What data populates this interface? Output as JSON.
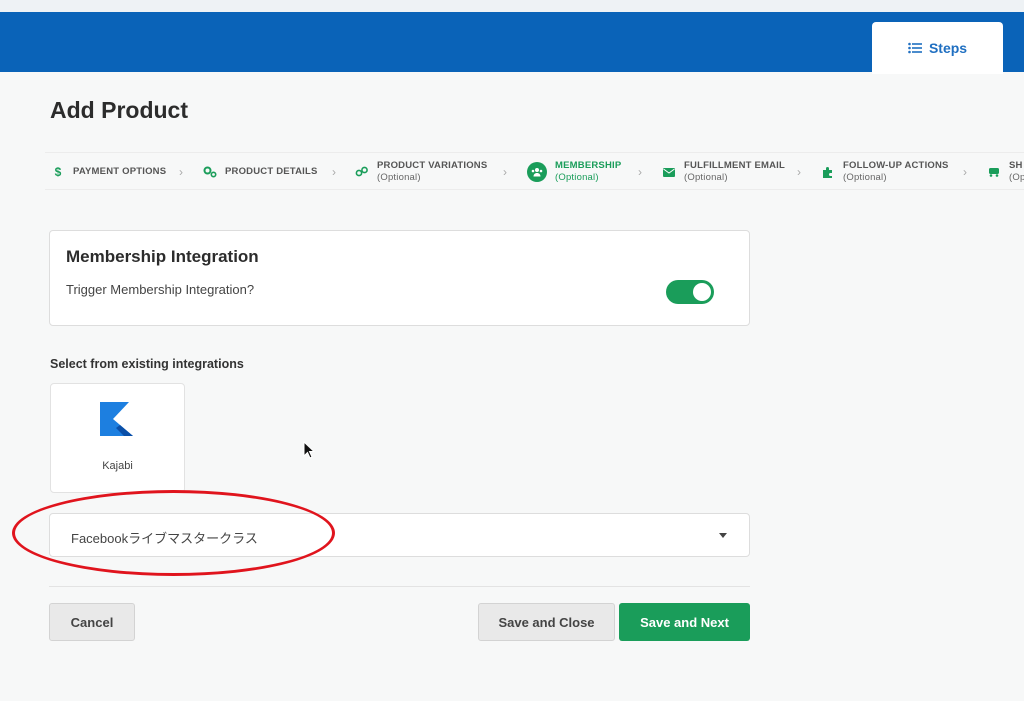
{
  "header": {
    "steps_label": "Steps",
    "steps_icon": "list-icon",
    "brand_color": "#0a63b8"
  },
  "page": {
    "title": "Add Product"
  },
  "wizard": {
    "accent_color": "#1a9d5a",
    "steps": [
      {
        "label": "PAYMENT OPTIONS",
        "sub": "",
        "icon": "dollar-icon",
        "active": false
      },
      {
        "label": "PRODUCT DETAILS",
        "sub": "",
        "icon": "gears-icon",
        "active": false
      },
      {
        "label": "PRODUCT VARIATIONS",
        "sub": "(Optional)",
        "icon": "variations-icon",
        "active": false
      },
      {
        "label": "MEMBERSHIP",
        "sub": "(Optional)",
        "icon": "users-icon",
        "active": true
      },
      {
        "label": "FULFILLMENT EMAIL",
        "sub": "(Optional)",
        "icon": "envelope-icon",
        "active": false
      },
      {
        "label": "FOLLOW-UP ACTIONS",
        "sub": "(Optional)",
        "icon": "puzzle-icon",
        "active": false
      },
      {
        "label": "SH",
        "sub": "(Op",
        "icon": "truck-icon",
        "active": false
      }
    ]
  },
  "membership": {
    "card_title": "Membership Integration",
    "question": "Trigger Membership Integration?",
    "toggle_on": true
  },
  "integrations": {
    "label": "Select from existing integrations",
    "items": [
      {
        "name": "Kajabi",
        "icon": "kajabi-logo-icon"
      }
    ]
  },
  "product_select": {
    "value": "Facebookライブマスタークラス"
  },
  "actions": {
    "cancel": "Cancel",
    "save_close": "Save and Close",
    "save_next": "Save and Next"
  }
}
